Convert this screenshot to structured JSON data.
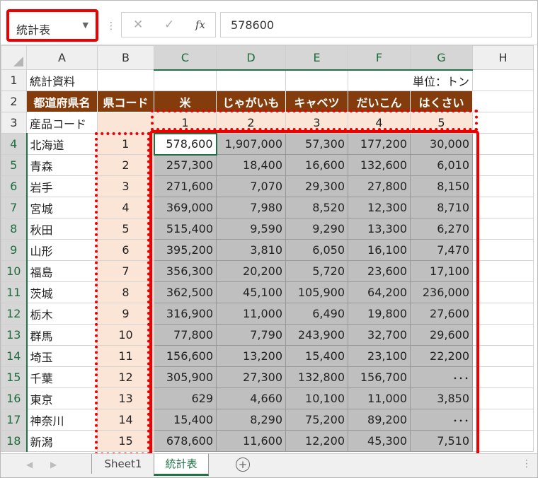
{
  "formula_bar": {
    "name_box": "統計表",
    "cancel_icon": "✕",
    "enter_icon": "✓",
    "fx_label": "fx",
    "value": "578600"
  },
  "columns": [
    "A",
    "B",
    "C",
    "D",
    "E",
    "F",
    "G",
    "H"
  ],
  "sheet": {
    "row1": {
      "a": "統計資料",
      "g": "単位：トン"
    },
    "headers": [
      "都道府県名",
      "県コード",
      "米",
      "じゃがいも",
      "キャベツ",
      "だいこん",
      "はくさい"
    ],
    "row3": {
      "a": "産品コード",
      "codes": [
        "1",
        "2",
        "3",
        "4",
        "5"
      ]
    },
    "rows": [
      {
        "num": "4",
        "pref": "北海道",
        "code": "1",
        "vals": [
          "578,600",
          "1,907,000",
          "57,300",
          "177,200",
          "30,000"
        ]
      },
      {
        "num": "5",
        "pref": "青森",
        "code": "2",
        "vals": [
          "257,300",
          "18,400",
          "16,600",
          "132,600",
          "6,010"
        ]
      },
      {
        "num": "6",
        "pref": "岩手",
        "code": "3",
        "vals": [
          "271,600",
          "7,070",
          "29,300",
          "27,800",
          "8,150"
        ]
      },
      {
        "num": "7",
        "pref": "宮城",
        "code": "4",
        "vals": [
          "369,000",
          "7,980",
          "8,520",
          "12,300",
          "8,710"
        ]
      },
      {
        "num": "8",
        "pref": "秋田",
        "code": "5",
        "vals": [
          "515,400",
          "9,590",
          "9,290",
          "13,300",
          "6,270"
        ]
      },
      {
        "num": "9",
        "pref": "山形",
        "code": "6",
        "vals": [
          "395,200",
          "3,810",
          "6,050",
          "16,100",
          "7,470"
        ]
      },
      {
        "num": "10",
        "pref": "福島",
        "code": "7",
        "vals": [
          "356,300",
          "20,200",
          "5,720",
          "23,600",
          "17,100"
        ]
      },
      {
        "num": "11",
        "pref": "茨城",
        "code": "8",
        "vals": [
          "362,500",
          "45,100",
          "105,900",
          "64,200",
          "236,000"
        ]
      },
      {
        "num": "12",
        "pref": "栃木",
        "code": "9",
        "vals": [
          "316,900",
          "11,000",
          "6,490",
          "19,800",
          "27,600"
        ]
      },
      {
        "num": "13",
        "pref": "群馬",
        "code": "10",
        "vals": [
          "77,800",
          "7,790",
          "243,900",
          "32,700",
          "29,600"
        ]
      },
      {
        "num": "14",
        "pref": "埼玉",
        "code": "11",
        "vals": [
          "156,600",
          "13,200",
          "15,400",
          "23,100",
          "22,200"
        ]
      },
      {
        "num": "15",
        "pref": "千葉",
        "code": "12",
        "vals": [
          "305,900",
          "27,300",
          "132,800",
          "156,700",
          "･･･"
        ]
      },
      {
        "num": "16",
        "pref": "東京",
        "code": "13",
        "vals": [
          "629",
          "4,660",
          "10,100",
          "11,000",
          "3,850"
        ]
      },
      {
        "num": "17",
        "pref": "神奈川",
        "code": "14",
        "vals": [
          "15,400",
          "8,290",
          "75,200",
          "89,200",
          "･･･"
        ]
      },
      {
        "num": "18",
        "pref": "新潟",
        "code": "15",
        "vals": [
          "678,600",
          "11,600",
          "12,200",
          "45,300",
          "7,510"
        ]
      }
    ]
  },
  "tabs": {
    "sheet1": "Sheet1",
    "active": "統計表",
    "add": "+"
  },
  "colors": {
    "header_bg": "#843c0c",
    "code_bg": "#fbe5d6",
    "data_bg": "#bfbfbf",
    "accent": "#217346",
    "highlight": "#ee0000"
  }
}
